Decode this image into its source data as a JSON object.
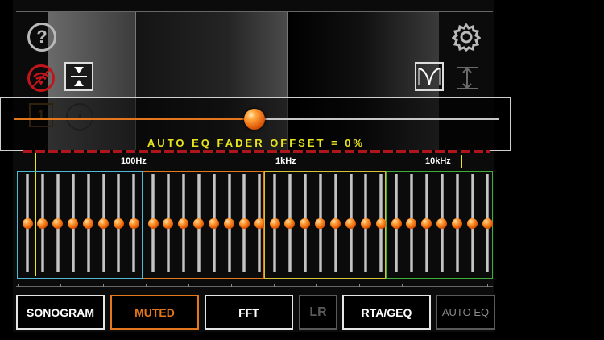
{
  "toolbar": {
    "help_icon_label": "?",
    "num_label": "1",
    "info_label": "i"
  },
  "slider": {
    "value_fraction": 0.497,
    "text": "AUTO EQ FADER OFFSET = 0%"
  },
  "freq_labels": [
    "100Hz",
    "1kHz",
    "10kHz"
  ],
  "colors": {
    "accent_orange": "#e4761b",
    "band_blue": "#4fb8d4",
    "band_orange": "#e07a1c",
    "band_yellow": "#d4c334",
    "band_green": "#3fae3b",
    "offset_yellow": "#e8e51e",
    "red_stripe": "#b0151c"
  },
  "bands": [
    {
      "name": "band-1",
      "color": "#4fb8d4",
      "fader_count": 8
    },
    {
      "name": "band-2",
      "color": "#e07a1c",
      "fader_count": 8
    },
    {
      "name": "band-3",
      "color": "#d4c334",
      "fader_count": 8
    },
    {
      "name": "band-4",
      "color": "#3fae3b",
      "fader_count": 7
    }
  ],
  "fader_levels": 0.5,
  "buttons": [
    {
      "label": "SONOGRAM",
      "state": "normal"
    },
    {
      "label": "MUTED",
      "state": "active"
    },
    {
      "label": "FFT",
      "state": "normal"
    },
    {
      "label": "LR",
      "state": "disabled"
    },
    {
      "label": "RTA/GEQ",
      "state": "normal"
    },
    {
      "label": "AUTO EQ",
      "state": "disabled"
    }
  ]
}
